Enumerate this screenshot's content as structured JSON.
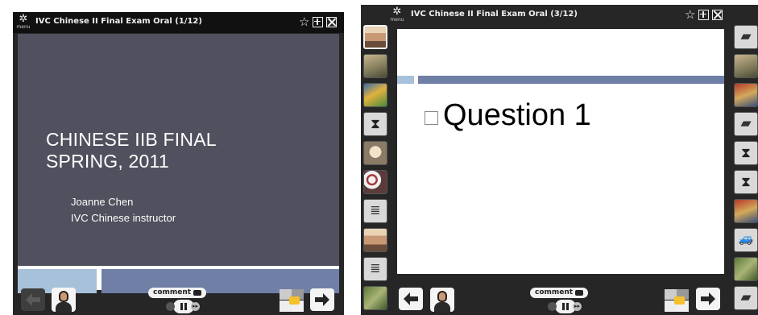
{
  "left_window": {
    "menu_label": "menu",
    "title": "IVC Chinese II Final Exam Oral (1/12)",
    "slide": {
      "title_line1": "CHINESE IIB FINAL",
      "title_line2": "SPRING, 2011",
      "author": "Joanne Chen",
      "role": "IVC Chinese instructor"
    },
    "comment_label": "comment",
    "prev_enabled": false,
    "next_enabled": true
  },
  "right_window": {
    "menu_label": "menu",
    "title": "IVC Chinese II Final Exam Oral (3/12)",
    "slide": {
      "heading": "Question 1"
    },
    "comment_label": "comment",
    "left_thumbs": [
      "face",
      "photo-tan",
      "bird",
      "hourglass",
      "face-light",
      "flower",
      "doc",
      "face",
      "doc",
      "photo-green"
    ],
    "right_thumbs": [
      "book",
      "photo-tan",
      "photo-red",
      "book",
      "hourglass",
      "hourglass",
      "photo-red",
      "car",
      "photo-green",
      "book"
    ]
  },
  "colors": {
    "frame_bg": "#262626",
    "titlebar_bg": "#111111",
    "slide_dark_bg": "#50505e",
    "accent_light_blue": "#a8c1da",
    "accent_slate_blue": "#6f7fa6",
    "highlight_yellow": "#f5c12b"
  },
  "icons": {
    "menu": "gear-icon",
    "favorite": "star-icon",
    "expand": "expand-icon",
    "close": "close-icon",
    "prev": "arrow-left-icon",
    "next": "arrow-right-icon",
    "play": "pause-icon",
    "documents": "documents-icon"
  }
}
